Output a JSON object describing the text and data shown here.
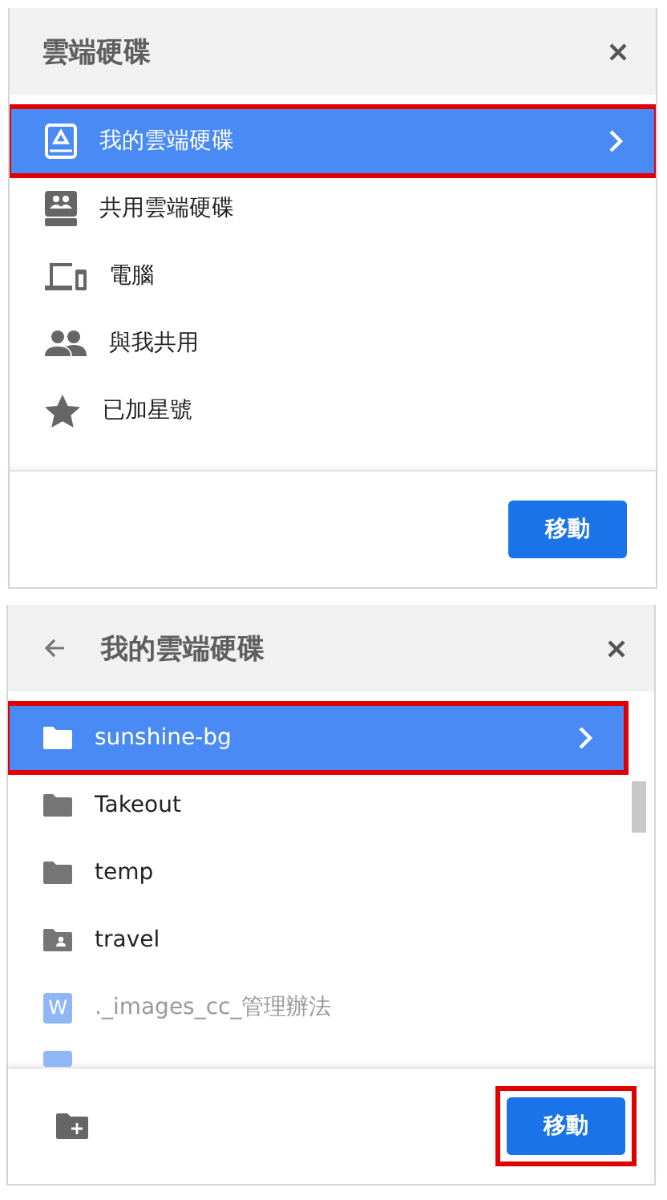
{
  "panels": [
    {
      "title": "雲端硬碟",
      "back": false,
      "new_folder": false,
      "scrollbar": false,
      "items": [
        {
          "kind": "my-drive",
          "label": "我的雲端硬碟",
          "selected": true,
          "highlighted": true,
          "disabled": false
        },
        {
          "kind": "shared-drive",
          "label": "共用雲端硬碟",
          "selected": false,
          "highlighted": false,
          "disabled": false
        },
        {
          "kind": "computer",
          "label": "電腦",
          "selected": false,
          "highlighted": false,
          "disabled": false
        },
        {
          "kind": "people",
          "label": "與我共用",
          "selected": false,
          "highlighted": false,
          "disabled": false
        },
        {
          "kind": "star",
          "label": "已加星號",
          "selected": false,
          "highlighted": false,
          "disabled": false
        }
      ],
      "button": {
        "label": "移動",
        "highlighted": false
      }
    },
    {
      "title": "我的雲端硬碟",
      "back": true,
      "new_folder": true,
      "scrollbar": true,
      "items": [
        {
          "kind": "folder",
          "label": "sunshine-bg",
          "selected": true,
          "highlighted": true,
          "disabled": false
        },
        {
          "kind": "folder",
          "label": "Takeout",
          "selected": false,
          "highlighted": false,
          "disabled": false
        },
        {
          "kind": "folder",
          "label": "temp",
          "selected": false,
          "highlighted": false,
          "disabled": false
        },
        {
          "kind": "shared-folder",
          "label": "travel",
          "selected": false,
          "highlighted": false,
          "disabled": false
        },
        {
          "kind": "doc",
          "badge": "W",
          "label": "._images_cc_管理辦法",
          "selected": false,
          "highlighted": false,
          "disabled": true
        }
      ],
      "button": {
        "label": "移動",
        "highlighted": true
      }
    }
  ]
}
